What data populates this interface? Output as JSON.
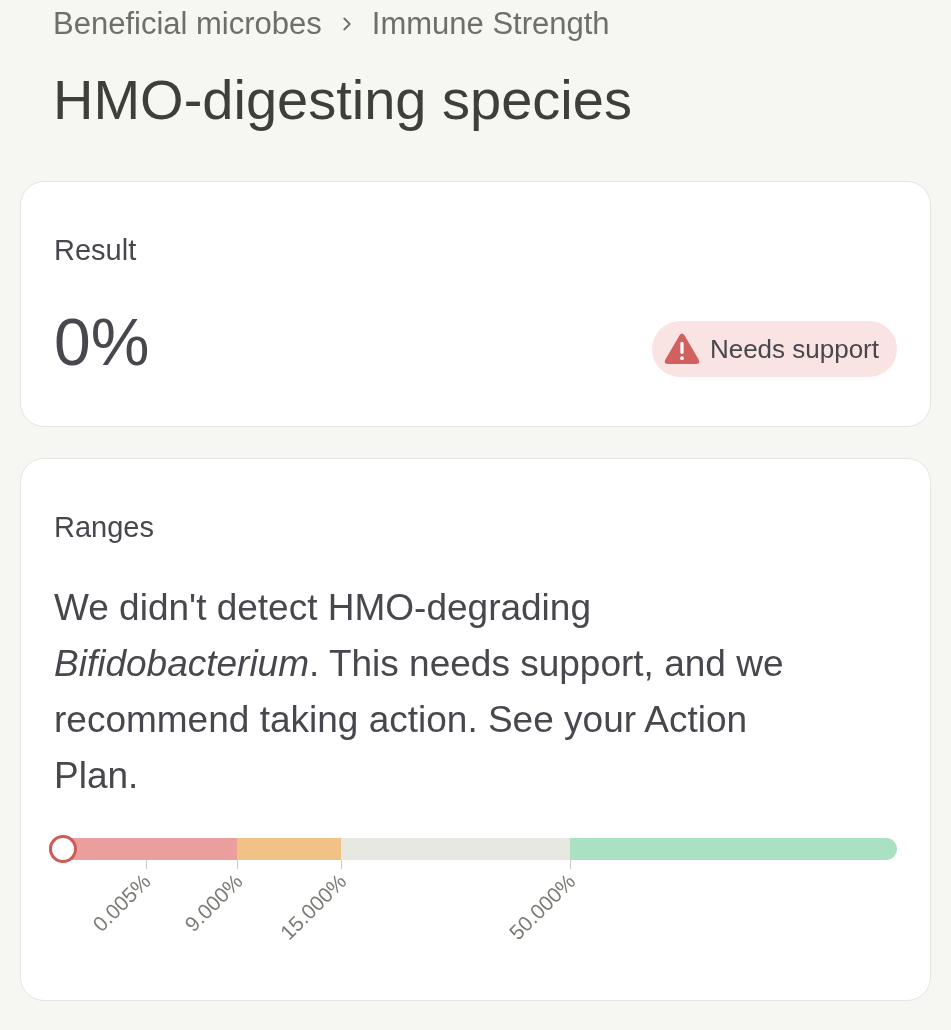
{
  "breadcrumb": [
    {
      "label": "Beneficial microbes"
    },
    {
      "label": "Immune Strength"
    }
  ],
  "title": "HMO-digesting species",
  "result": {
    "label": "Result",
    "value": "0%",
    "status": {
      "kind": "needs_support",
      "label": "Needs support"
    }
  },
  "ranges": {
    "label": "Ranges",
    "description": "We didn't detect HMO-degrading *Bifidobacterium*. This needs support, and we recommend taking action. See your Action Plan.",
    "marker": {
      "level": 0
    },
    "segments": [
      {
        "color": "#eb9e9e"
      },
      {
        "color": "#f1c185"
      },
      {
        "color": "#e8e8e3"
      },
      {
        "color": "#abe1c3"
      }
    ],
    "ticks": [
      {
        "label": "0.005%"
      },
      {
        "label": "9.000%"
      },
      {
        "label": "15.000%"
      },
      {
        "label": "50.000%"
      }
    ]
  }
}
